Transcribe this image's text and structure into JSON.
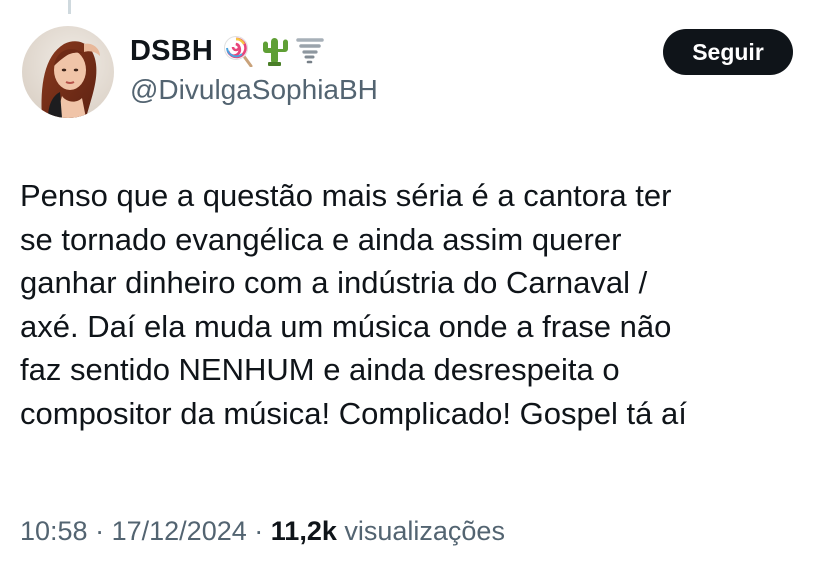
{
  "author": {
    "display_name": "DSBH",
    "handle": "@DivulgaSophiaBH",
    "name_emojis": [
      "lollipop-icon",
      "cactus-icon",
      "tornado-icon"
    ]
  },
  "follow_button": {
    "label": "Seguir"
  },
  "tweet": {
    "text": "Penso que a questão mais séria é a cantora ter\nse tornado evangélica e ainda assim querer\nganhar dinheiro com a indústria do Carnaval /\naxé.  Daí ela muda um música onde a frase não\nfaz sentido NENHUM e ainda desrespeita o\ncompositor da música! Complicado! Gospel tá aí"
  },
  "meta": {
    "time": "10:58",
    "separator": "·",
    "date": "17/12/2024",
    "views_count": "11,2k",
    "views_label": "visualizações"
  },
  "colors": {
    "text_primary": "#0f1419",
    "text_secondary": "#536471",
    "button_bg": "#0f1419",
    "button_text": "#ffffff"
  }
}
